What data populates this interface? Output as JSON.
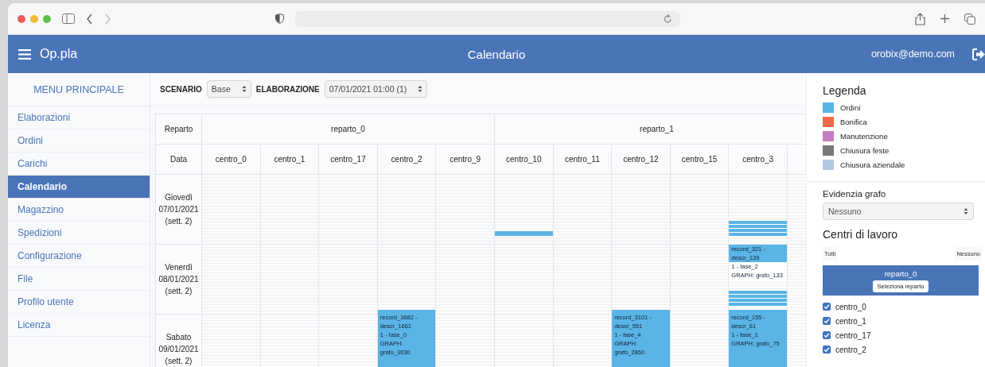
{
  "app": {
    "title": "Op.pla",
    "page_title": "Calendario",
    "user": "orobix@demo.com"
  },
  "sidebar": {
    "title": "MENU PRINCIPALE",
    "items": [
      {
        "label": "Elaborazioni",
        "selected": false
      },
      {
        "label": "Ordini",
        "selected": false
      },
      {
        "label": "Carichi",
        "selected": false
      },
      {
        "label": "Calendario",
        "selected": true
      },
      {
        "label": "Magazzino",
        "selected": false
      },
      {
        "label": "Spedizioni",
        "selected": false
      },
      {
        "label": "Configurazione",
        "selected": false
      },
      {
        "label": "File",
        "selected": false
      },
      {
        "label": "Profilo utente",
        "selected": false
      },
      {
        "label": "Licenza",
        "selected": false
      }
    ]
  },
  "toolbar": {
    "scenario_label": "SCENARIO",
    "scenario_value": "Base",
    "elaborazione_label": "ELABORAZIONE",
    "elaborazione_value": "07/01/2021 01:00 (1)"
  },
  "calendar": {
    "reparto_header": "Reparto",
    "data_header": "Data",
    "reparti": [
      {
        "name": "reparto_0",
        "centri": [
          "centro_0",
          "centro_1",
          "centro_17",
          "centro_2",
          "centro_9"
        ]
      },
      {
        "name": "reparto_1",
        "centri": [
          "centro_10",
          "centro_11",
          "centro_12",
          "centro_15",
          "centro_3"
        ]
      }
    ],
    "days": [
      {
        "weekday": "Giovedì",
        "date": "07/01/2021",
        "week": "(sett. 2)",
        "cells": [
          [],
          [],
          [],
          [],
          [],
          [
            {
              "kind": "bar"
            }
          ],
          [],
          [],
          [],
          [
            {
              "kind": "stripes"
            }
          ]
        ]
      },
      {
        "weekday": "Venerdì",
        "date": "08/01/2021",
        "week": "(sett. 2)",
        "cells": [
          [],
          [],
          [],
          [],
          [],
          [],
          [],
          [],
          [],
          [
            {
              "kind": "short-block",
              "lines": [
                "record_321 -",
                "descr_139",
                "1 - fase_2",
                "GRAPH: grafo_133"
              ]
            },
            {
              "kind": "stripes"
            }
          ]
        ]
      },
      {
        "weekday": "Sabato",
        "date": "09/01/2021",
        "week": "(sett. 2)",
        "cells": [
          [],
          [],
          [],
          [
            {
              "kind": "block",
              "lines": [
                "record_3682 -",
                "descr_1661",
                "1 - fase_0",
                "GRAPH:",
                "grafo_3030"
              ]
            }
          ],
          [],
          [],
          [],
          [
            {
              "kind": "block",
              "lines": [
                "record_3101 -",
                "descr_551",
                "1 - fase_4",
                "GRAPH:",
                "grafo_2860"
              ]
            }
          ],
          [],
          [
            {
              "kind": "block",
              "lines": [
                "record_155 -",
                "descr_61",
                "1 - fase_1",
                "GRAPH: grafo_75"
              ]
            }
          ]
        ]
      }
    ]
  },
  "legend": {
    "title": "Legenda",
    "items": [
      {
        "label": "Ordini",
        "color": "#5ab4e5"
      },
      {
        "label": "Bonifica",
        "color": "#ef6a4a"
      },
      {
        "label": "Manutenzione",
        "color": "#c57dc0"
      },
      {
        "label": "Chiusura feste",
        "color": "#777777"
      },
      {
        "label": "Chiusura aziendale",
        "color": "#b3c7e0"
      }
    ]
  },
  "highlight": {
    "label": "Evidenzia grafo",
    "value": "Nessuno"
  },
  "work_centers": {
    "title": "Centri di lavoro",
    "all_button": "Tutti",
    "none_button": "Nessuno",
    "groups": [
      {
        "name": "reparto_0",
        "button": "Seleziona reparto",
        "centri": [
          {
            "label": "centro_0",
            "checked": true
          },
          {
            "label": "centro_1",
            "checked": true
          },
          {
            "label": "centro_17",
            "checked": true
          },
          {
            "label": "centro_2",
            "checked": true
          }
        ]
      }
    ]
  }
}
